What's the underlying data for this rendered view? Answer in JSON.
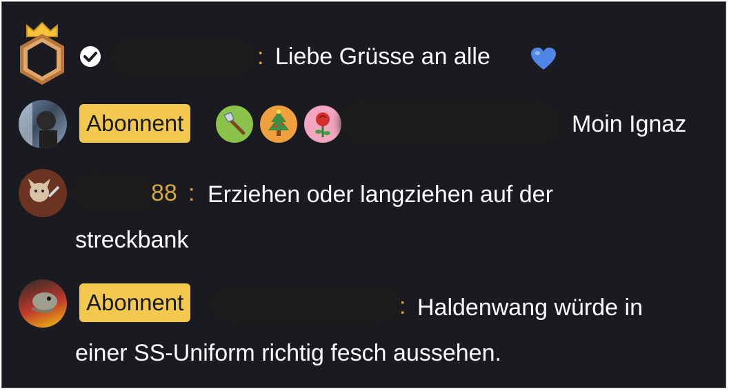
{
  "chat": {
    "messages": [
      {
        "username_suffix": "",
        "separator": ":",
        "text": "Liebe Grüsse an alle",
        "emoji": "💙"
      },
      {
        "badge": "Abonnent",
        "text": "Moin Ignaz"
      },
      {
        "username_suffix": "88",
        "separator": ":",
        "text_line1": "Erziehen oder langziehen auf der",
        "text_line2": "streckbank"
      },
      {
        "badge": "Abonnent",
        "separator": ":",
        "text_line1": "Haldenwang würde in",
        "text_line2": "einer SS-Uniform richtig fesch aussehen."
      }
    ]
  },
  "colors": {
    "background": "#1a1b21",
    "badge": "#f2c94c",
    "username": "#d4a63a",
    "text": "#ffffff"
  },
  "icons": {
    "message1": [
      "crown-avatar-frame-icon",
      "verified-check-icon",
      "blue-heart-emoji"
    ],
    "message2": [
      "axe-badge-icon",
      "christmas-tree-badge-icon",
      "rose-badge-icon"
    ]
  }
}
